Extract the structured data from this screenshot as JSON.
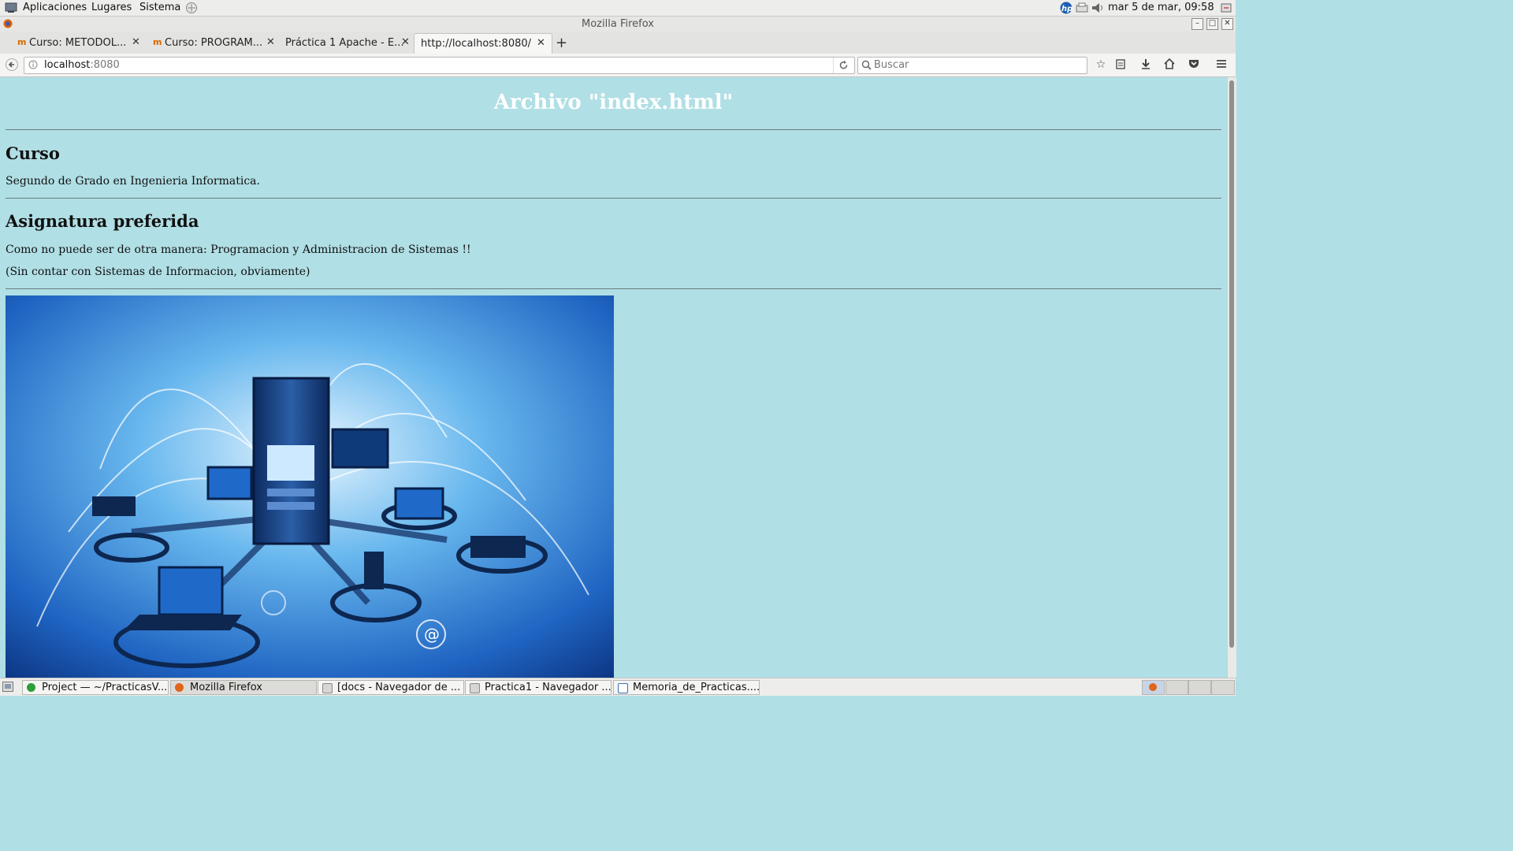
{
  "top_panel": {
    "menus": [
      "Aplicaciones",
      "Lugares",
      "Sistema"
    ],
    "clock": "mar  5 de mar, 09:58",
    "icons": [
      "apps-menu-icon",
      "network-icon",
      "hp-icon",
      "printer-icon",
      "volume-icon",
      "shutdown-icon"
    ]
  },
  "window": {
    "title": "Mozilla Firefox"
  },
  "tabs": [
    {
      "label": "Curso: METODOL...",
      "icon": "moodle-icon"
    },
    {
      "label": "Curso: PROGRAM...",
      "icon": "moodle-icon"
    },
    {
      "label": "Práctica 1 Apache - E...",
      "icon": ""
    },
    {
      "label": "http://localhost:8080/",
      "icon": "",
      "selected": true
    }
  ],
  "navbar": {
    "url_host": "localhost",
    "url_port": ":8080",
    "search_placeholder": "Buscar"
  },
  "page": {
    "title": "Archivo \"index.html\"",
    "section1_heading": "Curso",
    "section1_text": "Segundo de Grado en Ingenieria Informatica.",
    "section2_heading": "Asignatura preferida",
    "section2_text1": "Como no puede ser de otra manera: Programacion y Administracion de Sistemas !!",
    "section2_text2": "(Sin contar con Sistemas de Informacion, obviamente)"
  },
  "taskbar": [
    {
      "label": "Project — ~/PracticasV...",
      "icon_color": "#2e9d3a",
      "active": false
    },
    {
      "label": "Mozilla Firefox",
      "icon_color": "#e0641a",
      "active": true
    },
    {
      "label": "[docs - Navegador de ...",
      "icon_color": "#9a9a98",
      "active": false
    },
    {
      "label": "Practica1 - Navegador ...",
      "icon_color": "#9a9a98",
      "active": false
    },
    {
      "label": "Memoria_de_Practicas....",
      "icon_color": "#3a6fb5",
      "active": false
    }
  ],
  "colors": {
    "page_background": "#b0dfe5",
    "title_color": "#ffffff"
  }
}
